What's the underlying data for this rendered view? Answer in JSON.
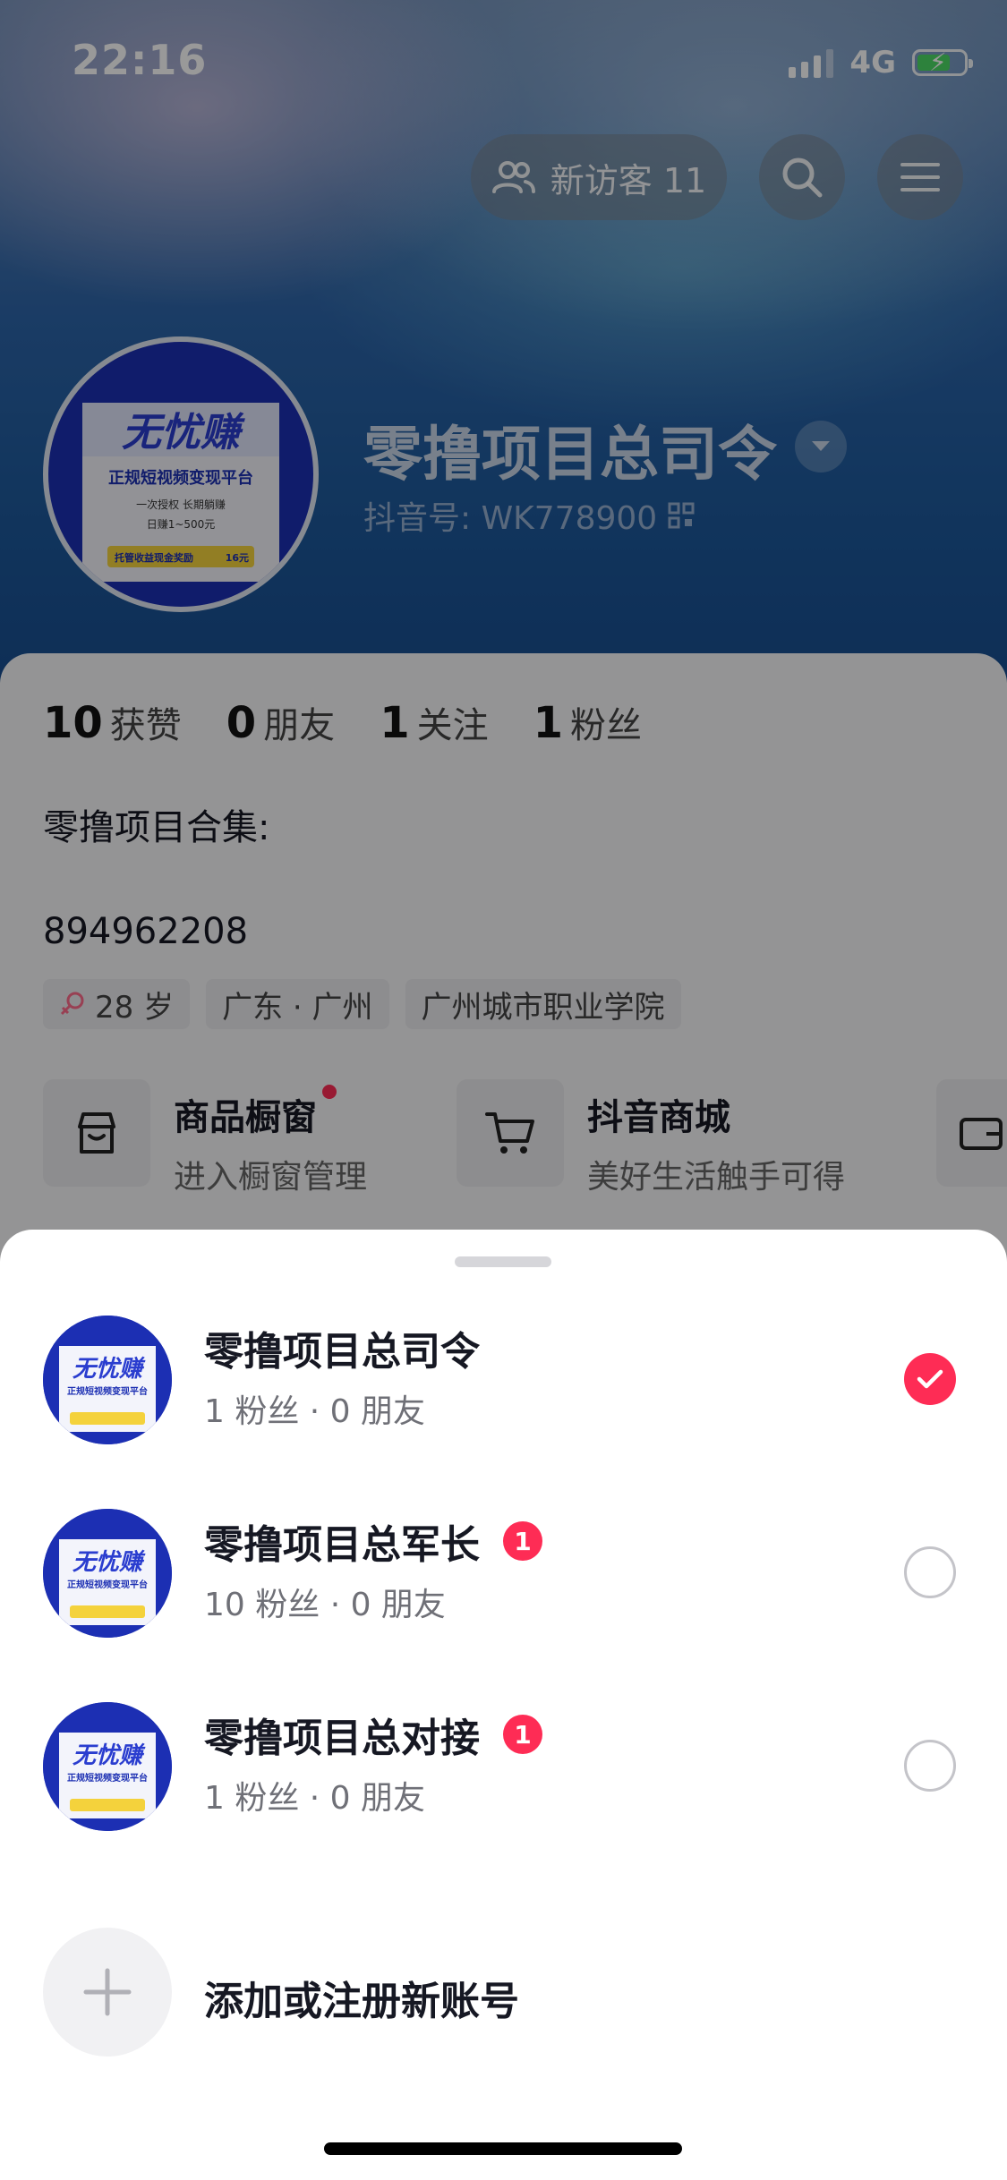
{
  "status_bar": {
    "time": "22:16",
    "network": "4G"
  },
  "header": {
    "visitor_button_label": "新访客 11",
    "profile_name": "零撸项目总司令",
    "douyin_id": "抖音号: WK778900"
  },
  "avatar_art": {
    "headline": "无忧赚",
    "tagline": "正规短视频变现平台",
    "line1": "一次授权  长期躺赚",
    "line2": "日赚1~500元",
    "footer": "托管收益现金奖励",
    "footer_value": "16元"
  },
  "stats": [
    {
      "num": "10",
      "label": "获赞"
    },
    {
      "num": "0",
      "label": "朋友"
    },
    {
      "num": "1",
      "label": "关注"
    },
    {
      "num": "1",
      "label": "粉丝"
    }
  ],
  "bio": {
    "title": "零撸项目合集:",
    "number": "894962208"
  },
  "tags": {
    "age": "28 岁",
    "location": "广东 · 广州",
    "school": "广州城市职业学院"
  },
  "cards": [
    {
      "title": "商品橱窗",
      "subtitle": "进入橱窗管理"
    },
    {
      "title": "抖音商城",
      "subtitle": "美好生活触手可得"
    }
  ],
  "account_sheet": {
    "accounts": [
      {
        "name": "零撸项目总司令",
        "sub": "1 粉丝 · 0 朋友",
        "badge": "",
        "selected": true
      },
      {
        "name": "零撸项目总军长",
        "sub": "10 粉丝 · 0 朋友",
        "badge": "1",
        "selected": false
      },
      {
        "name": "零撸项目总对接",
        "sub": "1 粉丝 · 0 朋友",
        "badge": "1",
        "selected": false
      }
    ],
    "add_label": "添加或注册新账号"
  },
  "colors": {
    "accent": "#fe2c55",
    "header_blue": "#2c64a8",
    "avatar_blue": "#1c2fb3",
    "avatar_yellow": "#f4d23c"
  }
}
